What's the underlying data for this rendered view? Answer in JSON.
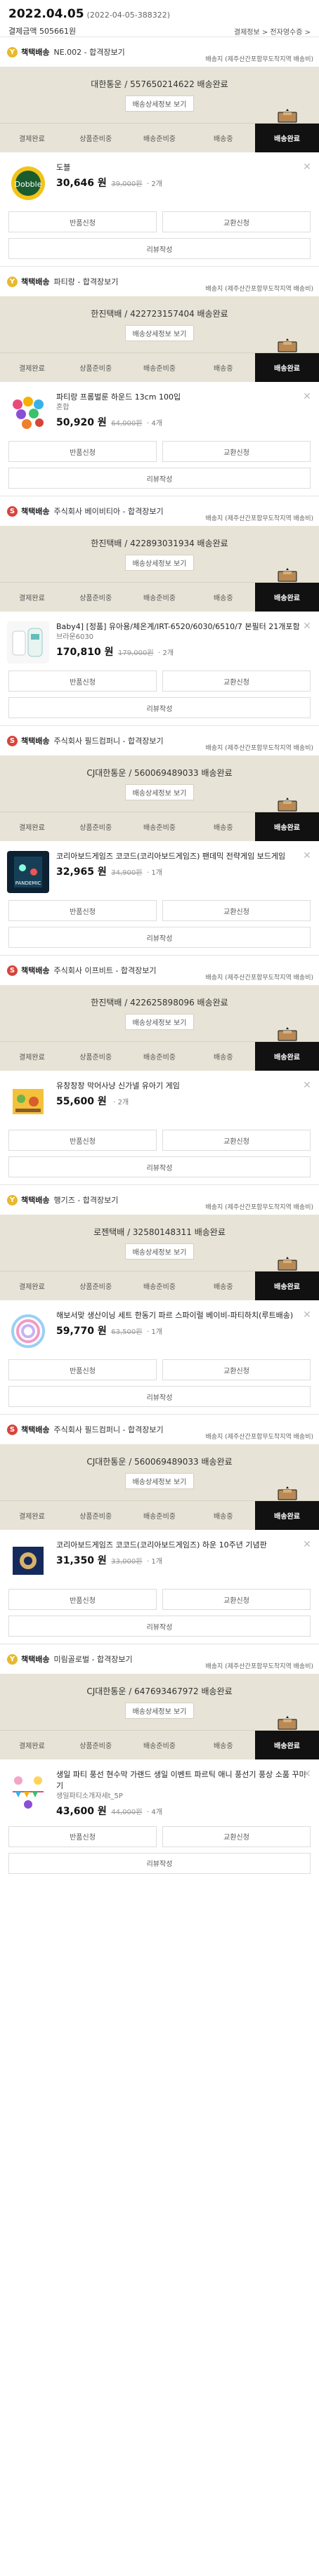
{
  "header": {
    "date": "2022.04.05",
    "order_no": "(2022-04-05-388322)",
    "sum_label": "결제금액 505661원",
    "links": "결제정보 > 전자영수증 >"
  },
  "labels": {
    "track": "배송상세정보 보기",
    "return": "반품신청",
    "exchange": "교환신청",
    "review": "리뷰작성",
    "close": "✕"
  },
  "steps": [
    "결제완료",
    "상품준비중",
    "배송준비중",
    "배송중",
    "배송완료"
  ],
  "shipments": [
    {
      "badge": "Y",
      "type": "책택배송",
      "seller": "NE.002 - 합격장보기",
      "ship_info": "배송지 (제주산간포함무도착지역 배송비)",
      "carrier": "대한통운 / 557650214622 배송완료",
      "product": {
        "name": "도블",
        "option": "",
        "price": "30,646 원",
        "orig": "39,000원",
        "qty": "· 2개",
        "thumb": "dobble"
      }
    },
    {
      "badge": "Y",
      "type": "책택배송",
      "seller": "파티랑 - 합격장보기",
      "ship_info": "배송지 (제주산간포함무도착지역 배송비)",
      "carrier": "한진택배 / 422723157404 배송완료",
      "product": {
        "name": "파티랑 프롬벌룬 하운드 13cm 100입",
        "option": "혼합",
        "price": "50,920 원",
        "orig": "64,000원",
        "qty": "· 4개",
        "thumb": "balloon"
      }
    },
    {
      "badge": "S",
      "type": "책택배송",
      "seller": "주식회사 베이비티아 - 합격장보기",
      "ship_info": "배송지 (제주산간포함무도착지역 배송비)",
      "carrier": "한진택배 / 422893031934 배송완료",
      "product": {
        "name": "Baby4] [정품] 유아용/체온계/IRT-6520/6030/6510/7 본필터 21개포함",
        "option": "브라운6030",
        "price": "170,810 원",
        "orig": "179,000원",
        "qty": "· 2개",
        "thumb": "baby"
      }
    },
    {
      "badge": "S",
      "type": "책택배송",
      "seller": "주식회사 필드컴퍼니 - 합격장보기",
      "ship_info": "배송지 (제주산간포함무도착지역 배송비)",
      "carrier": "CJ대한통운 / 560069489033 배송완료",
      "product": {
        "name": "코리아보드게임즈 코코드(코리아보드게임즈) 팬데믹 전략게임 보드게임",
        "option": "",
        "price": "32,965 원",
        "orig": "34,900원",
        "qty": "· 1개",
        "thumb": "pandemic"
      }
    },
    {
      "badge": "S",
      "type": "책택배송",
      "seller": "주식회사 이프비트 - 합격장보기",
      "ship_info": "배송지 (제주산간포함무도착지역 배송비)",
      "carrier": "한진택배 / 422625898096 배송완료",
      "product": {
        "name": "유창창창 막어사냥 신가넬 유아기 게임",
        "option": "",
        "price": "55,600 원",
        "orig": "",
        "qty": "· 2개",
        "thumb": "animal"
      }
    },
    {
      "badge": "Y",
      "type": "책택배송",
      "seller": "행기즈 - 합격장보기",
      "ship_info": "배송지 (제주산간포함무도착지역 배송비)",
      "carrier": "로젠택배 / 32580148311 배송완료",
      "product": {
        "name": "해보서맞 생산이닝 세트 한동기 파르 스파이럴 베이비-파티하치(루트배송)",
        "option": "",
        "price": "59,770 원",
        "orig": "63,500원",
        "qty": "· 1개",
        "thumb": "spiral"
      }
    },
    {
      "badge": "S",
      "type": "책택배송",
      "seller": "주식회사 필드컴퍼니 - 합격장보기",
      "ship_info": "배송지 (제주산간포함무도착지역 배송비)",
      "carrier": "CJ대한통운 / 560069489033 배송완료",
      "product": {
        "name": "코리아보드게임즈 코코드(코리아보드게임즈) 하운 10주년 기념판",
        "option": "",
        "price": "31,350 원",
        "orig": "33,000원",
        "qty": "· 1개",
        "thumb": "board"
      }
    },
    {
      "badge": "Y",
      "type": "책택배송",
      "seller": "미림골로벌 - 합격장보기",
      "ship_info": "배송지 (제주산간포함무도착지역 배송비)",
      "carrier": "CJ대한통운 / 647693467972 배송완료",
      "product": {
        "name": "생일 파티 풍선 현수막 가랜드 생일 이벤트 파르틱 애니 풍선기 풍상 소품 꾸미기",
        "option": "생일파티소개자세t_5P",
        "price": "43,600 원",
        "orig": "44,000원",
        "qty": "· 4개",
        "thumb": "party"
      }
    }
  ]
}
